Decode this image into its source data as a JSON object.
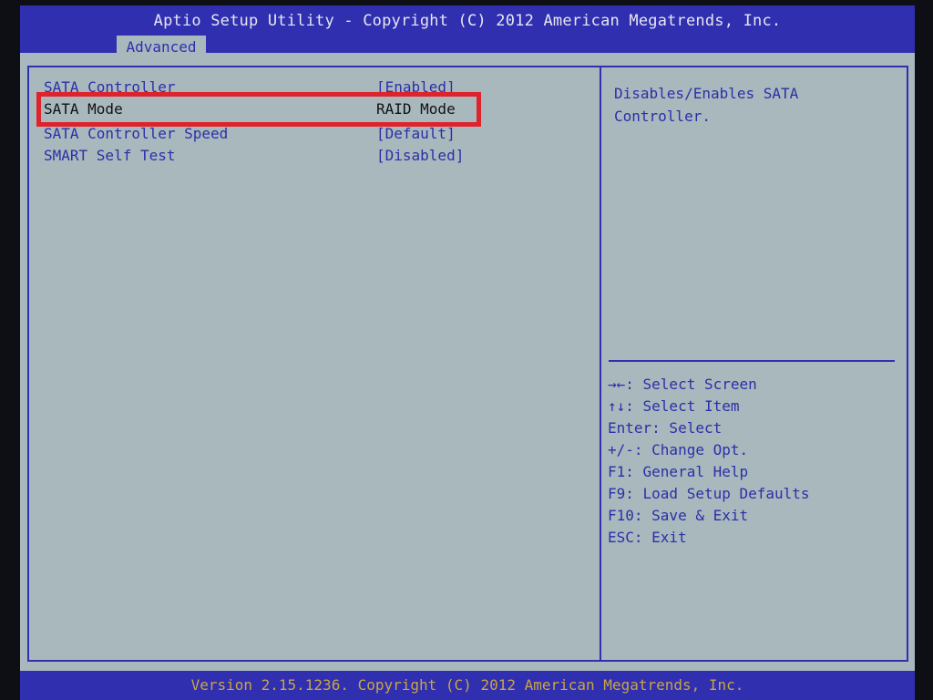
{
  "header": {
    "title": "Aptio Setup Utility - Copyright (C) 2012 American Megatrends, Inc.",
    "active_tab": "Advanced"
  },
  "settings": [
    {
      "label": "SATA Controller",
      "value": "[Enabled]"
    },
    {
      "label": "SATA Mode",
      "value": "RAID Mode"
    },
    {
      "label": "SATA Controller Speed",
      "value": "[Default]"
    },
    {
      "label": "SMART Self Test",
      "value": "[Disabled]"
    }
  ],
  "help": {
    "text": "Disables/Enables SATA\nController."
  },
  "keys": [
    "→←: Select Screen",
    "↑↓: Select Item",
    "Enter: Select",
    "+/-: Change Opt.",
    "F1: General Help",
    "F9: Load Setup Defaults",
    "F10: Save & Exit",
    "ESC: Exit"
  ],
  "footer": {
    "version": "Version 2.15.1236. Copyright (C) 2012 American Megatrends, Inc."
  },
  "colors": {
    "bar_blue": "#2f2fb0",
    "panel_gray": "#a9b8bd",
    "highlight_red": "#e0232b",
    "footer_text": "#c9a545"
  }
}
